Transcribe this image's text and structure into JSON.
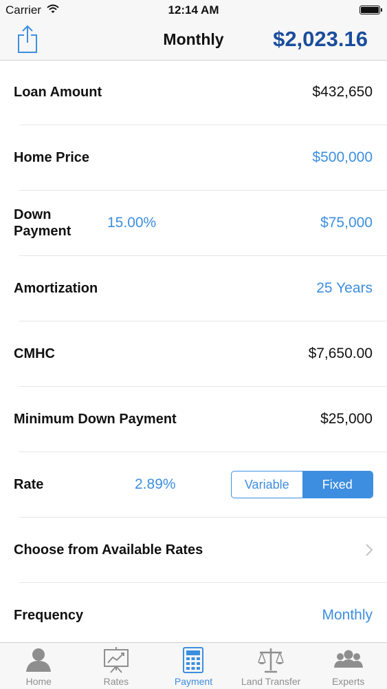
{
  "status_bar": {
    "carrier": "Carrier",
    "time": "12:14 AM"
  },
  "nav": {
    "title": "Monthly",
    "payment": "$2,023.16"
  },
  "rows": {
    "loan_amount": {
      "label": "Loan Amount",
      "value": "$432,650"
    },
    "home_price": {
      "label": "Home Price",
      "value": "$500,000"
    },
    "down_payment": {
      "label_line1": "Down",
      "label_line2": "Payment",
      "percent": "15.00%",
      "value": "$75,000"
    },
    "amortization": {
      "label": "Amortization",
      "value": "25 Years"
    },
    "cmhc": {
      "label": "CMHC",
      "value": "$7,650.00"
    },
    "min_down": {
      "label": "Minimum Down Payment",
      "value": "$25,000"
    },
    "rate": {
      "label": "Rate",
      "value": "2.89%",
      "options": [
        "Variable",
        "Fixed"
      ],
      "selected": "Fixed"
    },
    "choose_rates": {
      "label": "Choose from Available Rates"
    },
    "frequency": {
      "label": "Frequency",
      "value": "Monthly"
    }
  },
  "tabs": [
    {
      "label": "Home",
      "icon": "person-icon"
    },
    {
      "label": "Rates",
      "icon": "chart-easel-icon"
    },
    {
      "label": "Payment",
      "icon": "calculator-icon",
      "active": true
    },
    {
      "label": "Land Transfer",
      "icon": "scales-icon"
    },
    {
      "label": "Experts",
      "icon": "group-icon"
    }
  ],
  "colors": {
    "accent": "#3d8ee0",
    "payment_text": "#1a4d9c",
    "inactive_tab": "#8e8e8e"
  }
}
